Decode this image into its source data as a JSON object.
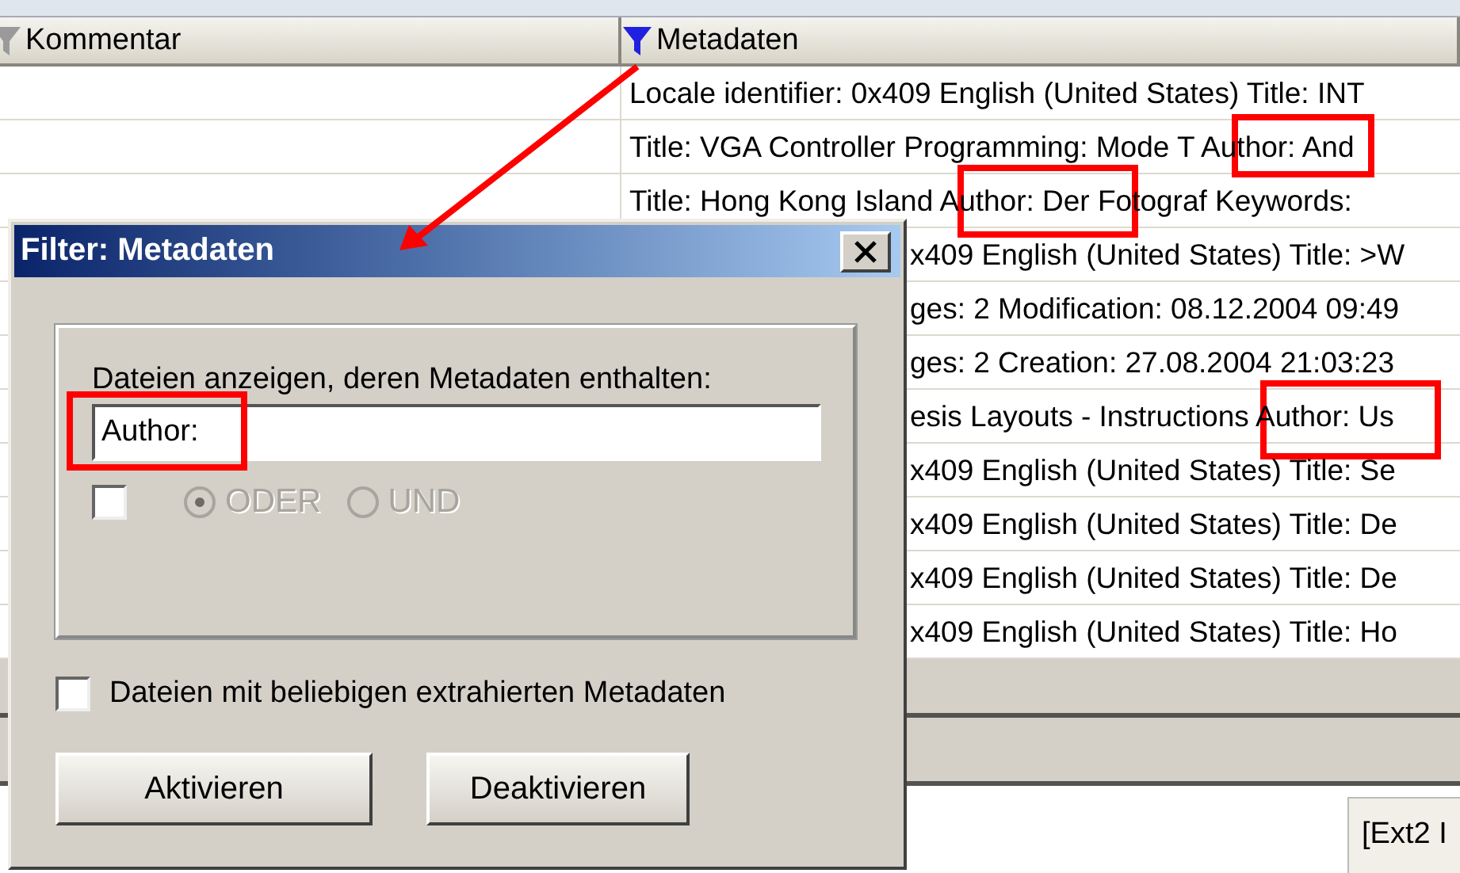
{
  "table": {
    "columns": [
      {
        "label": "Kommentar",
        "filtered": false
      },
      {
        "label": "Metadaten",
        "filtered": true
      }
    ],
    "rows": [
      {
        "kind": "full",
        "metadata": "Locale identifier: 0x409 English (United States) Title: INT"
      },
      {
        "kind": "full",
        "metadata": "Title: VGA Controller Programming: Mode T Author: And"
      },
      {
        "kind": "full",
        "metadata": "Title: Hong Kong Island Author: Der Fotograf Keywords:"
      },
      {
        "kind": "partial",
        "metadata": "x409 English (United States) Title: >W"
      },
      {
        "kind": "partial",
        "metadata": "ges: 2 Modification: 08.12.2004 09:49"
      },
      {
        "kind": "partial",
        "metadata": "ges: 2 Creation: 27.08.2004 21:03:23"
      },
      {
        "kind": "partial",
        "metadata": "esis Layouts - Instructions Author: Us"
      },
      {
        "kind": "partial",
        "metadata": "x409 English (United States) Title: Se"
      },
      {
        "kind": "partial",
        "metadata": "x409 English (United States) Title: De"
      },
      {
        "kind": "partial",
        "metadata": "x409 English (United States) Title: De"
      },
      {
        "kind": "partial",
        "metadata": "x409 English (United States) Title: Ho"
      }
    ]
  },
  "tooltip": "[Ext2 I",
  "dialog": {
    "title": "Filter: Metadaten",
    "prompt": "Dateien anzeigen, deren Metadaten enthalten:",
    "value": "Author:",
    "option_checked": false,
    "radios": [
      {
        "label": "ODER",
        "selected": true,
        "disabled": true
      },
      {
        "label": "UND",
        "selected": false,
        "disabled": true
      }
    ],
    "any_metadata": {
      "label": "Dateien mit beliebigen extrahierten Metadaten",
      "checked": false
    },
    "buttons": [
      "Aktivieren",
      "Deaktivieren"
    ]
  }
}
